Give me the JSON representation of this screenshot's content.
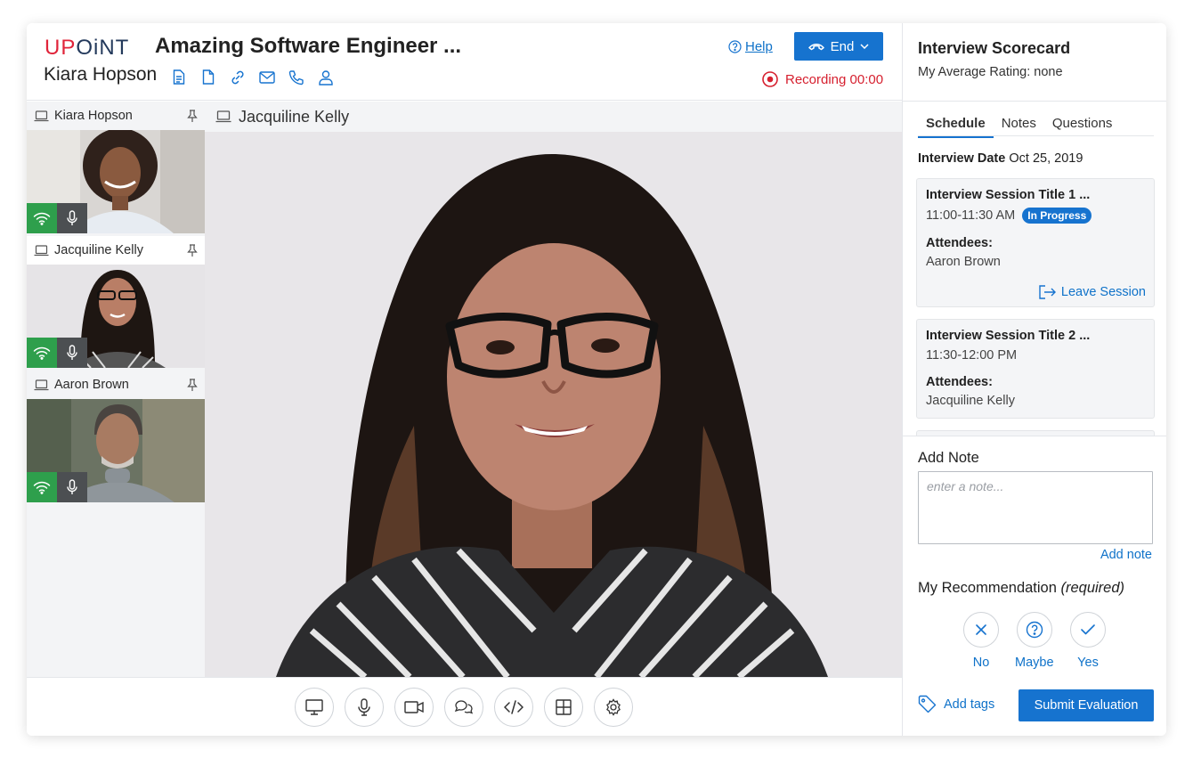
{
  "header": {
    "logo_prefix": "UP",
    "logo_rest": "OiNT",
    "job_title": "Amazing Software Engineer ...",
    "candidate_name": "Kiara Hopson",
    "candidate_icons": [
      "document-icon",
      "file-icon",
      "link-icon",
      "mail-icon",
      "phone-icon",
      "user-icon"
    ],
    "help_label": "Help",
    "end_label": "End",
    "recording_label": "Recording 00:00"
  },
  "participants": [
    {
      "name": "Kiara Hopson",
      "active": false
    },
    {
      "name": "Jacquiline Kelly",
      "active": true
    },
    {
      "name": "Aaron Brown",
      "active": false
    }
  ],
  "stage": {
    "speaker_name": "Jacquiline  Kelly"
  },
  "toolbar": {
    "tools": [
      "screen-share-icon",
      "microphone-icon",
      "camera-icon",
      "chat-icon",
      "code-icon",
      "layout-grid-icon",
      "settings-icon"
    ]
  },
  "scorecard": {
    "title": "Interview Scorecard",
    "rating": "My Average Rating: none",
    "tabs": [
      "Schedule",
      "Notes",
      "Questions"
    ],
    "active_tab": "Schedule",
    "interview_date_label": "Interview Date",
    "interview_date": "Oct 25, 2019",
    "sessions": [
      {
        "title": "Interview Session Title 1 ...",
        "time": "11:00-11:30 AM",
        "status": "In Progress",
        "attendees_label": "Attendees:",
        "attendees": "Aaron Brown",
        "action": "Leave Session"
      },
      {
        "title": "Interview Session Title 2 ...",
        "time": "11:30-12:00 PM",
        "status": "",
        "attendees_label": "Attendees:",
        "attendees": "Jacquiline Kelly",
        "action": ""
      }
    ],
    "add_note_label": "Add Note",
    "note_placeholder": "enter a note...",
    "add_note_link": "Add note",
    "recommendation_label": "My Recommendation",
    "recommendation_required": "(required)",
    "recommendation_options": [
      "No",
      "Maybe",
      "Yes"
    ],
    "add_tags_label": "Add tags",
    "submit_label": "Submit Evaluation"
  },
  "colors": {
    "primary": "#1673cf",
    "recording": "#d6202f",
    "active_tile": "#f3953a",
    "network_ok": "#2e9f4c",
    "logo_red": "#e0243a",
    "logo_navy": "#23395b"
  }
}
